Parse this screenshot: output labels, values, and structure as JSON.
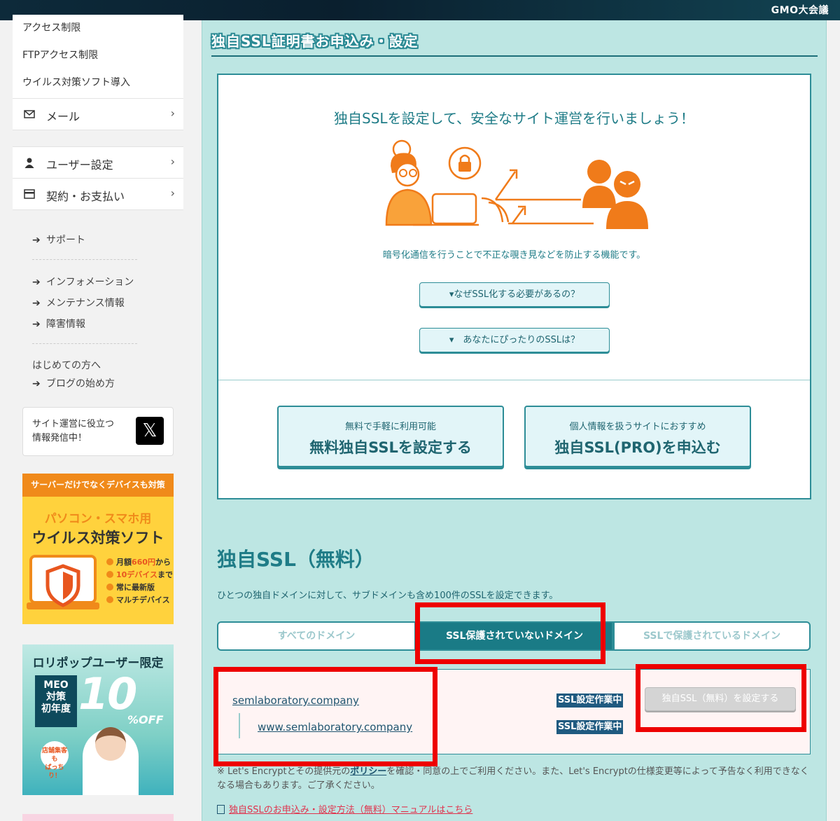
{
  "header": {
    "brand": "GMO大会議"
  },
  "sidebar": {
    "sub_items": [
      "アクセス制限",
      "FTPアクセス制限",
      "ウイルス対策ソフト導入"
    ],
    "boxes": [
      {
        "label": "メール",
        "icon": "mail-icon"
      },
      {
        "label": "ユーザー設定",
        "icon": "user-icon"
      },
      {
        "label": "契約・お支払い",
        "icon": "credit-card-icon"
      }
    ],
    "support": "サポート",
    "info_links": [
      "インフォメーション",
      "メンテナンス情報",
      "障害情報"
    ],
    "first_time": "はじめての方へ",
    "blog": "ブログの始め方",
    "x_promo": "サイト運営に役立つ\n情報発信中！",
    "x_logo": "𝕏",
    "ad1": {
      "header": "サーバーだけでなくデバイスも対策",
      "line1": "パソコン・スマホ用",
      "line2": "ウイルス対策ソフト",
      "bullets": [
        {
          "pre": "月額",
          "em": "660円",
          "post": "から"
        },
        {
          "pre": "",
          "em": "10デバイス",
          "post": "まで"
        },
        {
          "pre": "常に最新版",
          "em": "",
          "post": ""
        },
        {
          "pre": "マルチデバイス",
          "em": "",
          "post": ""
        }
      ]
    },
    "ad2": {
      "header": "ロリポップユーザー限定",
      "meo": "MEO\n対策\n初年度",
      "big": "10",
      "off": "%OFF",
      "tag": "店舗集客も\nばっちり！"
    }
  },
  "main": {
    "page_title": "独自SSL証明書お申込み・設定",
    "headline": "独自SSLを設定して、安全なサイト運営を行いましょう！",
    "desc": "暗号化通信を行うことで不正な覗き見などを防止する機能です。",
    "faq1": "▾なぜSSL化する必要があるの？",
    "faq2": "▾　あなたにぴったりのSSLは？",
    "cta_free_small": "無料で手軽に利用可能",
    "cta_free_big": "無料独自SSLを設定する",
    "cta_pro_small": "個人情報を扱うサイトにおすすめ",
    "cta_pro_big": "独自SSL(PRO)を申込む",
    "section_title": "独自SSL（無料）",
    "section_desc": "ひとつの独自ドメインに対して、サブドメインも含め100件のSSLを設定できます。",
    "tabs": [
      "すべてのドメイン",
      "SSL保護されていないドメイン",
      "SSLで保護されているドメイン"
    ],
    "domain": "semlaboratory.company",
    "subdomain": "www.semlaboratory.company",
    "badge": "SSL設定作業中",
    "set_button": "独自SSL（無料）を設定する",
    "note_pre": "※ Let's Encryptとその提供元の",
    "note_policy": "ポリシー",
    "note_post": "を確認・同意の上でご利用ください。また、Let's Encryptの仕様変更等によって予告なく利用できなくなる場合もあります。ご了承ください。",
    "manual": "独自SSLのお申込み・設定方法（無料）マニュアルはこちら"
  },
  "colors": {
    "accent": "#2d8d97",
    "highlight": "#ee0000",
    "illustration": "#f07b1a"
  }
}
